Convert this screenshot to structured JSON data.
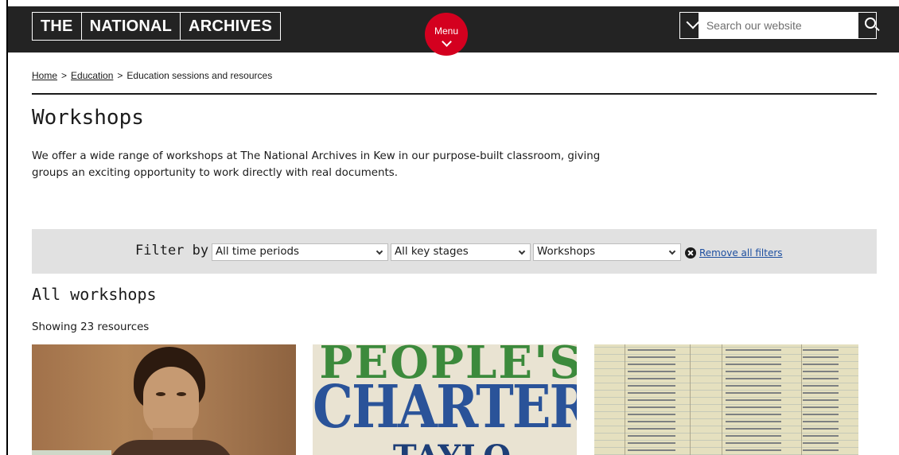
{
  "header": {
    "logo_parts": [
      "THE",
      "NATIONAL",
      "ARCHIVES"
    ],
    "menu_label": "Menu",
    "search_placeholder": "Search our website"
  },
  "breadcrumb": {
    "items": [
      "Home",
      "Education",
      "Education sessions and resources"
    ],
    "separator": ">"
  },
  "page": {
    "title": "Workshops",
    "intro": "We offer a wide range of workshops at The National Archives in Kew in our purpose-built classroom, giving groups an exciting opportunity to work directly with real documents."
  },
  "filters": {
    "label": "Filter by",
    "time_period": "All time periods",
    "key_stage": "All key stages",
    "resource_type": "Workshops",
    "remove_label": "Remove all filters"
  },
  "results": {
    "heading": "All workshops",
    "count_text": "Showing 23 resources"
  },
  "cards": {
    "poster_line1": "PEOPLE'S",
    "poster_line2": "CHARTER.",
    "poster_line3": "TAYLO"
  },
  "colors": {
    "header_bg": "#232323",
    "menu_red": "#d4001f",
    "filter_bg": "#e1e1e1",
    "link_blue": "#1d4fa0"
  }
}
